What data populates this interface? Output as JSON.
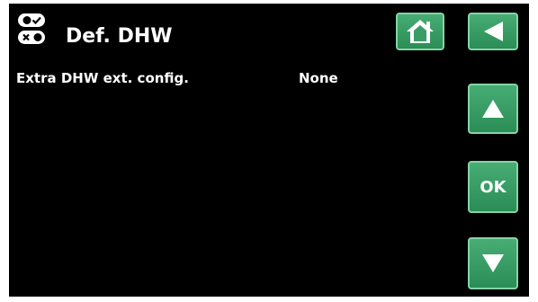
{
  "header": {
    "title": "Def. DHW",
    "title_icon": "switch-toggles-icon"
  },
  "settings": [
    {
      "label": "Extra DHW ext. config.",
      "value": "None"
    }
  ],
  "buttons": {
    "home_icon": "home-icon",
    "back_icon": "back-arrow-icon",
    "up_icon": "up-arrow-icon",
    "ok_label": "OK",
    "down_icon": "down-arrow-icon"
  },
  "colors": {
    "background": "#000000",
    "button_green": "#3a9d66",
    "button_border": "#86d3a6",
    "text": "#ffffff"
  }
}
